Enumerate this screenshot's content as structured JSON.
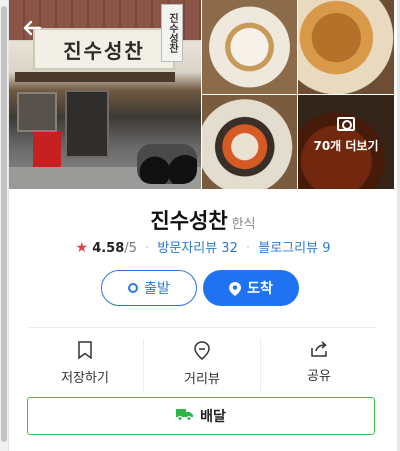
{
  "photos": {
    "main_sign": "진수성찬",
    "side_sign": "진수성찬",
    "more_label": "70개 더보기"
  },
  "place": {
    "name": "진수성찬",
    "category": "한식",
    "rating": "4.58",
    "rating_max": "/5",
    "visitor_reviews": "방문자리뷰 32",
    "blog_reviews": "블로그리뷰 9"
  },
  "buttons": {
    "start": "출발",
    "arrive": "도착"
  },
  "actions": [
    {
      "label": "저장하기",
      "icon": "bookmark-icon"
    },
    {
      "label": "거리뷰",
      "icon": "map-pin-outline-icon"
    },
    {
      "label": "공유",
      "icon": "share-icon"
    }
  ],
  "delivery_label": "배달",
  "colors": {
    "accent": "#1f73f0",
    "link": "#2a7ad8",
    "star": "#e24343",
    "delivery_border": "#3ec24f"
  }
}
